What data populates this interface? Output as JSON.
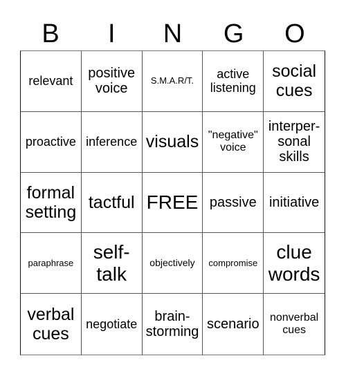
{
  "header": {
    "letters": [
      "B",
      "I",
      "N",
      "G",
      "O"
    ]
  },
  "card": {
    "cells": [
      [
        "relevant",
        "positive voice",
        "S.M.A.R/T.",
        "active listening",
        "social cues"
      ],
      [
        "proactive",
        "inference",
        "visuals",
        "\"negative\" voice",
        "interper- sonal skills"
      ],
      [
        "formal setting",
        "tactful",
        "FREE",
        "passive",
        "initiative"
      ],
      [
        "paraphrase",
        "self- talk",
        "objectively",
        "compromise",
        "clue words"
      ],
      [
        "verbal cues",
        "negotiate",
        "brain- storming",
        "scenario",
        "nonverbal cues"
      ]
    ]
  }
}
